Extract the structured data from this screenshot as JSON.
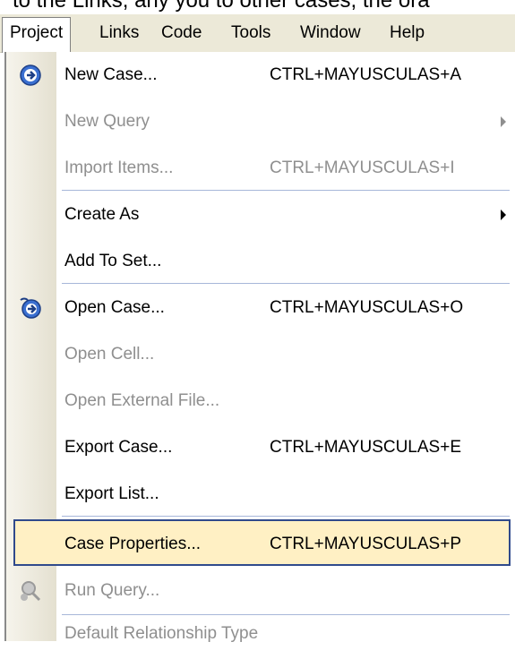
{
  "background_text": "to the Links, any you to other cases, the ora",
  "menubar": {
    "items": [
      {
        "label": "Project",
        "active": true
      },
      {
        "label": "Links"
      },
      {
        "label": "Code"
      },
      {
        "label": "Tools"
      },
      {
        "label": "Window"
      },
      {
        "label": "Help"
      }
    ]
  },
  "menu": {
    "items": [
      {
        "label": "New Case...",
        "shortcut": "CTRL+MAYUSCULAS+A",
        "enabled": true,
        "icon": "new-case-icon"
      },
      {
        "label": "New Query",
        "shortcut": "",
        "enabled": false,
        "submenu": true
      },
      {
        "label": "Import Items...",
        "shortcut": "CTRL+MAYUSCULAS+I",
        "enabled": false
      },
      {
        "label": "Create As",
        "shortcut": "",
        "enabled": true,
        "submenu": true
      },
      {
        "label": "Add To Set...",
        "shortcut": "",
        "enabled": true
      },
      {
        "label": "Open Case...",
        "shortcut": "CTRL+MAYUSCULAS+O",
        "enabled": true,
        "icon": "open-case-icon"
      },
      {
        "label": "Open Cell...",
        "shortcut": "",
        "enabled": false
      },
      {
        "label": "Open External File...",
        "shortcut": "",
        "enabled": false
      },
      {
        "label": "Export Case...",
        "shortcut": "CTRL+MAYUSCULAS+E",
        "enabled": true
      },
      {
        "label": "Export List...",
        "shortcut": "",
        "enabled": true
      },
      {
        "label": "Case Properties...",
        "shortcut": "CTRL+MAYUSCULAS+P",
        "enabled": true,
        "highlighted": true
      },
      {
        "label": "Run Query...",
        "shortcut": "",
        "enabled": false,
        "icon": "run-query-icon"
      },
      {
        "label": "Default Relationship Type",
        "shortcut": "",
        "enabled": false
      }
    ]
  },
  "colors": {
    "highlight_bg": "#fff0c4",
    "highlight_border": "#304a8c",
    "disabled_text": "#8f8f8f",
    "separator": "#a7b7d9"
  }
}
